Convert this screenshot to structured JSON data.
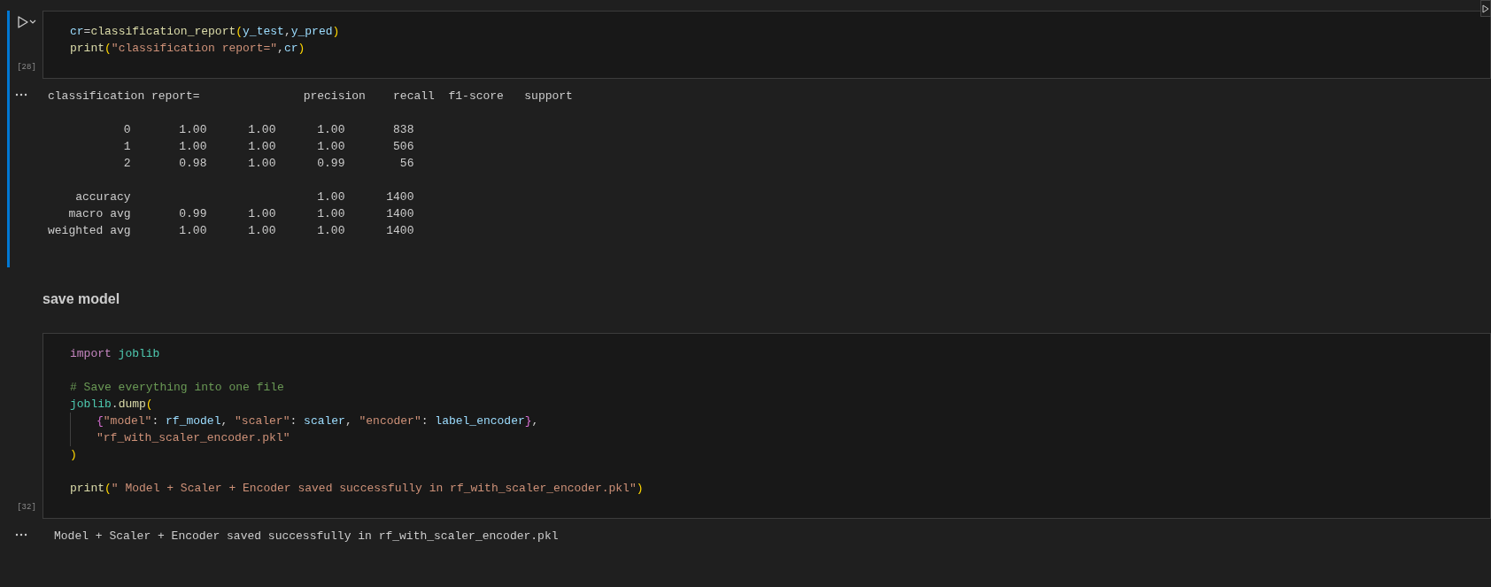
{
  "cells": [
    {
      "kind": "code",
      "execution_count": "[28]",
      "active": true,
      "code_blocks": [
        [
          {
            "indented": false,
            "tokens": [
              {
                "kind": "variable",
                "text": "cr"
              },
              {
                "kind": "punct",
                "text": "="
              },
              {
                "kind": "function",
                "text": "classification_report"
              },
              {
                "kind": "bracket",
                "text": "("
              },
              {
                "kind": "variable",
                "text": "y_test"
              },
              {
                "kind": "punct",
                "text": ","
              },
              {
                "kind": "variable",
                "text": "y_pred"
              },
              {
                "kind": "bracket",
                "text": ")"
              }
            ]
          },
          {
            "indented": false,
            "tokens": [
              {
                "kind": "function",
                "text": "print"
              },
              {
                "kind": "bracket",
                "text": "("
              },
              {
                "kind": "string",
                "text": "\"classification report=\""
              },
              {
                "kind": "punct",
                "text": ","
              },
              {
                "kind": "variable",
                "text": "cr"
              },
              {
                "kind": "bracket",
                "text": ")"
              }
            ]
          }
        ]
      ],
      "output": {
        "blocks": [
          [
            "classification report=               precision    recall  f1-score   support"
          ],
          [
            "           0       1.00      1.00      1.00       838",
            "           1       1.00      1.00      1.00       506",
            "           2       0.98      1.00      0.99        56"
          ],
          [
            "    accuracy                           1.00      1400",
            "   macro avg       0.99      1.00      1.00      1400",
            "weighted avg       1.00      1.00      1.00      1400"
          ]
        ]
      }
    },
    {
      "kind": "markdown",
      "heading": "save model"
    },
    {
      "kind": "code",
      "execution_count": "[32]",
      "active": false,
      "code_blocks": [
        [
          {
            "indented": false,
            "tokens": [
              {
                "kind": "keyword",
                "text": "import"
              },
              {
                "kind": "module",
                "text": " joblib"
              }
            ]
          }
        ],
        [
          {
            "indented": false,
            "tokens": [
              {
                "kind": "comment",
                "text": "# Save everything into one file"
              }
            ]
          },
          {
            "indented": false,
            "tokens": [
              {
                "kind": "module",
                "text": "joblib"
              },
              {
                "kind": "punct",
                "text": "."
              },
              {
                "kind": "function",
                "text": "dump"
              },
              {
                "kind": "bracket",
                "text": "("
              }
            ]
          },
          {
            "indented": true,
            "tokens": [
              {
                "kind": "brace",
                "text": "{"
              },
              {
                "kind": "string",
                "text": "\"model\""
              },
              {
                "kind": "punct",
                "text": ": "
              },
              {
                "kind": "variable",
                "text": "rf_model"
              },
              {
                "kind": "punct",
                "text": ", "
              },
              {
                "kind": "string",
                "text": "\"scaler\""
              },
              {
                "kind": "punct",
                "text": ": "
              },
              {
                "kind": "variable",
                "text": "scaler"
              },
              {
                "kind": "punct",
                "text": ", "
              },
              {
                "kind": "string",
                "text": "\"encoder\""
              },
              {
                "kind": "punct",
                "text": ": "
              },
              {
                "kind": "variable",
                "text": "label_encoder"
              },
              {
                "kind": "brace",
                "text": "}"
              },
              {
                "kind": "punct",
                "text": ","
              }
            ]
          },
          {
            "indented": true,
            "tokens": [
              {
                "kind": "string",
                "text": "\"rf_with_scaler_encoder.pkl\""
              }
            ]
          },
          {
            "indented": false,
            "tokens": [
              {
                "kind": "bracket",
                "text": ")"
              }
            ]
          }
        ],
        [
          {
            "indented": false,
            "tokens": [
              {
                "kind": "function",
                "text": "print"
              },
              {
                "kind": "bracket",
                "text": "("
              },
              {
                "kind": "string",
                "text": "\" Model + Scaler + Encoder saved successfully in rf_with_scaler_encoder.pkl\""
              },
              {
                "kind": "bracket",
                "text": ")"
              }
            ]
          }
        ]
      ],
      "output": {
        "blocks": [
          [
            "Model + Scaler + Encoder saved successfully in rf_with_scaler_encoder.pkl"
          ]
        ]
      }
    }
  ]
}
